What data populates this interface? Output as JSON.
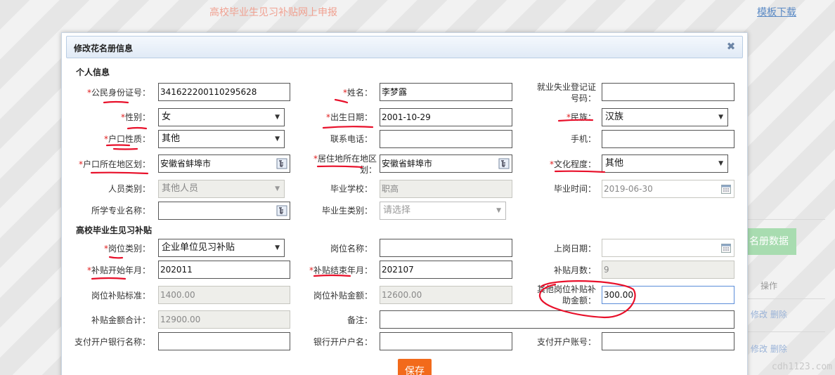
{
  "background": {
    "page_title": "高校毕业生见习补贴网上申报",
    "template_link": "模板下载",
    "import_button": "名册数据",
    "op_header": "操作",
    "row_actions": [
      "修改 删除",
      "修改 删除"
    ],
    "watermark": "cdh1123.com"
  },
  "dialog": {
    "title": "修改花名册信息",
    "close_icon": "close-icon",
    "save_label": "保存"
  },
  "sections": {
    "personal": "个人信息",
    "subsidy": "高校毕业生见习补贴"
  },
  "personal": {
    "id_no": {
      "label": "公民身份证号：",
      "value": "341622200110295628",
      "required": true
    },
    "name": {
      "label": "姓名：",
      "value": "李梦露",
      "required": true
    },
    "employment_reg": {
      "label1": "就业失业登记证",
      "label2": "号码：",
      "value": ""
    },
    "gender": {
      "label": "性别：",
      "value": "女",
      "required": true
    },
    "birth_date": {
      "label": "出生日期：",
      "value": "2001-10-29",
      "required": true
    },
    "ethnicity": {
      "label": "民族：",
      "value": "汉族",
      "required": true
    },
    "hukou_type": {
      "label": "户口性质：",
      "value": "其他",
      "required": true
    },
    "phone": {
      "label": "联系电话：",
      "value": ""
    },
    "mobile": {
      "label": "手机：",
      "value": ""
    },
    "hukou_region": {
      "label": "户口所在地区划：",
      "value": "安徽省蚌埠市",
      "required": true
    },
    "residence_region": {
      "label1": "居住地所在地区",
      "label2": "划：",
      "value": "安徽省蚌埠市",
      "required": true
    },
    "education": {
      "label": "文化程度：",
      "value": "其他",
      "required": true
    },
    "person_type": {
      "label": "人员类别：",
      "value": "其他人员"
    },
    "school": {
      "label": "毕业学校：",
      "value": "职高"
    },
    "grad_date": {
      "label": "毕业时间：",
      "value": "2019-06-30"
    },
    "major": {
      "label": "所学专业名称：",
      "value": ""
    },
    "grad_type": {
      "label": "毕业生类别：",
      "value": "请选择"
    }
  },
  "subsidy": {
    "post_type": {
      "label": "岗位类别：",
      "value": "企业单位见习补贴",
      "required": true
    },
    "post_name": {
      "label": "岗位名称：",
      "value": ""
    },
    "start_work_date": {
      "label": "上岗日期：",
      "value": ""
    },
    "start_month": {
      "label": "补贴开始年月：",
      "value": "202011",
      "required": true
    },
    "end_month": {
      "label": "补贴结束年月：",
      "value": "202107",
      "required": true
    },
    "months": {
      "label": "补贴月数：",
      "value": "9"
    },
    "post_standard": {
      "label": "岗位补贴标准：",
      "value": "1400.00"
    },
    "post_amount": {
      "label": "岗位补贴金额：",
      "value": "12600.00"
    },
    "other_subsidy": {
      "label1": "其他岗位补贴补",
      "label2": "助金额：",
      "value": "300.00"
    },
    "total": {
      "label": "补贴金额合计：",
      "value": "12900.00"
    },
    "remark": {
      "label": "备注：",
      "value": ""
    },
    "bank_name": {
      "label": "支付开户银行名称：",
      "value": ""
    },
    "account_name": {
      "label": "银行开户户名：",
      "value": ""
    },
    "account_no": {
      "label": "支付开户账号：",
      "value": ""
    }
  },
  "colors": {
    "accent": "#f26a1b",
    "required_star": "#e02020",
    "annotation": "#e8102a"
  }
}
